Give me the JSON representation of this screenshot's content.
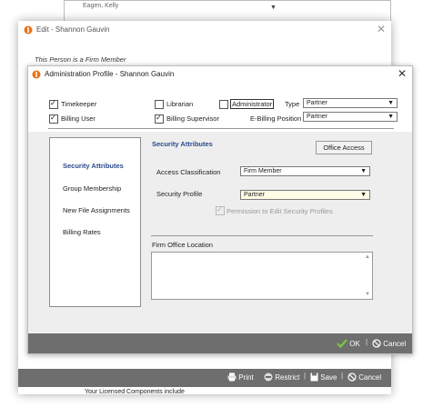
{
  "background_window": {
    "visible_name": "Eagen, Kelly"
  },
  "outer_window": {
    "title": "Edit - Shannon Gauvin",
    "subtitle": "This Person is a Firm Member",
    "toolbar": {
      "print": "Print",
      "restrict": "Restrict",
      "save": "Save",
      "cancel": "Cancel"
    },
    "footer_text": "Your Licensed Components include"
  },
  "dialog": {
    "title": "Administration Profile - Shannon Gauvin",
    "checkboxes": {
      "timekeeper": {
        "label": "Timekeeper",
        "checked": true
      },
      "billing_user": {
        "label": "Billing User",
        "checked": true
      },
      "librarian": {
        "label": "Librarian",
        "checked": false
      },
      "billing_supervisor": {
        "label": "Billing Supervisor",
        "checked": true
      },
      "administrator": {
        "label": "Administrator",
        "checked": false
      }
    },
    "type": {
      "label": "Type",
      "value": "Partner"
    },
    "ebilling_position": {
      "label": "E-Billing Position",
      "value": "Partner"
    },
    "nav": {
      "items": [
        {
          "label": "Security Attributes",
          "active": true
        },
        {
          "label": "Group Membership",
          "active": false
        },
        {
          "label": "New File Assignments",
          "active": false
        },
        {
          "label": "Billing Rates",
          "active": false
        }
      ]
    },
    "security": {
      "title": "Security Attributes",
      "office_access_button": "Office Access",
      "access_classification": {
        "label": "Access Classification",
        "value": "Firm Member"
      },
      "security_profile": {
        "label": "Security Profile",
        "value": "Partner"
      },
      "permission_checkbox": {
        "label": "Permission to Edit Security Profiles",
        "checked": true,
        "disabled": true
      }
    },
    "firm_office_location": {
      "label": "Firm Office Location",
      "value": ""
    },
    "buttons": {
      "ok": "OK",
      "cancel": "Cancel"
    }
  },
  "colors": {
    "bar_gray": "#6e6e6e",
    "accent_blue": "#2a4a8a",
    "ok_green": "#7ec73f",
    "app_icon_orange": "#e8731c"
  }
}
